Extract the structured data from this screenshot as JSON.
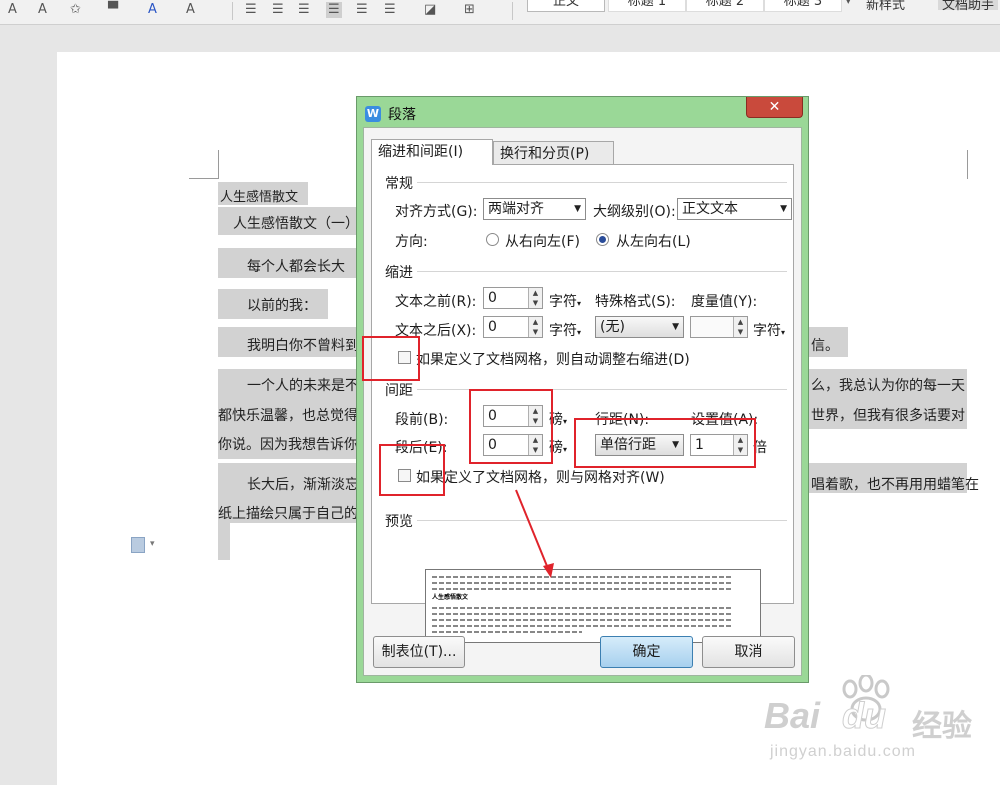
{
  "toolbar": {
    "styles": [
      "正文",
      "标题 1",
      "标题 2",
      "标题 3"
    ],
    "new_style": "新样式",
    "assistant": "文档助手"
  },
  "document": {
    "lines": [
      "人生感悟散文",
      "人生感悟散文（一）",
      "每个人都会长大",
      "以前的我：",
      "我明白你不曾料到",
      "信。",
      "一个人的未来是不",
      "么，我总认为你的每一天",
      "都快乐温馨，也总觉得",
      "世界，但我有很多话要对",
      "你说。因为我想告诉你",
      "长大后，渐渐淡忘",
      "唱着歌，也不再用用蜡笔在",
      "纸上描绘只属于自己的"
    ]
  },
  "dialog": {
    "title": "段落",
    "app_icon": "W",
    "close_glyph": "✕",
    "tabs": [
      "缩进和间距(I)",
      "换行和分页(P)"
    ],
    "general": {
      "heading": "常规",
      "alignment_label": "对齐方式(G):",
      "alignment_value": "两端对齐",
      "outline_label": "大纲级别(O):",
      "outline_value": "正文文本",
      "direction_label": "方向:",
      "rtl_label": "从右向左(F)",
      "ltr_label": "从左向右(L)"
    },
    "indent": {
      "heading": "缩进",
      "before_label": "文本之前(R):",
      "before_value": "0",
      "before_unit": "字符",
      "after_label": "文本之后(X):",
      "after_value": "0",
      "after_unit": "字符",
      "special_label": "特殊格式(S):",
      "special_value": "(无)",
      "measure_label": "度量值(Y):",
      "measure_value": "",
      "measure_unit": "字符",
      "grid_checkbox": "如果定义了文档网格，则自动调整右缩进(D)"
    },
    "spacing": {
      "heading": "间距",
      "before_label": "段前(B):",
      "before_value": "0",
      "before_unit": "磅",
      "after_label": "段后(E):",
      "after_value": "0",
      "after_unit": "磅",
      "line_label": "行距(N):",
      "line_value": "单倍行距",
      "setting_label": "设置值(A):",
      "setting_value": "1",
      "setting_unit": "倍",
      "grid_checkbox": "如果定义了文档网格，则与网格对齐(W)"
    },
    "preview": {
      "heading": "预览",
      "sample": "人生感悟散文"
    },
    "buttons": {
      "tabs": "制表位(T)...",
      "ok": "确定",
      "cancel": "取消"
    }
  },
  "watermark": {
    "brand": "Bai",
    "brand2": "du",
    "cn": "经验",
    "url": "jingyan.baidu.com"
  },
  "colors": {
    "dialog_frame": "#9ad897",
    "highlight": "#e0232b",
    "selection": "#d2d2d2"
  }
}
